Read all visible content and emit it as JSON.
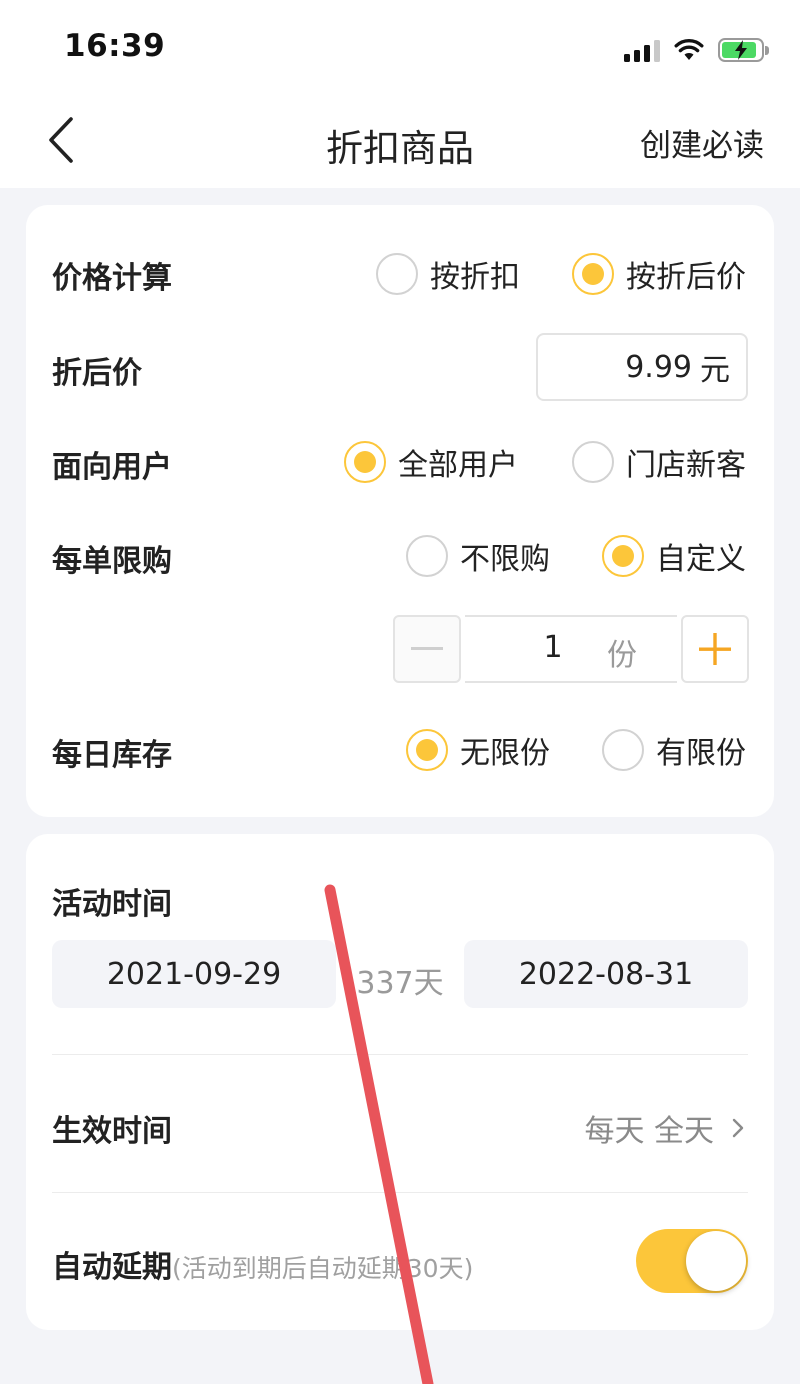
{
  "status_bar": {
    "time": "16:39"
  },
  "nav": {
    "title": "折扣商品",
    "right_link": "创建必读"
  },
  "price_calc": {
    "label": "价格计算",
    "options": [
      {
        "label": "按折扣",
        "selected": false
      },
      {
        "label": "按折后价",
        "selected": true
      }
    ]
  },
  "discount_price": {
    "label": "折后价",
    "value": "9.99",
    "unit": "元"
  },
  "target_users": {
    "label": "面向用户",
    "options": [
      {
        "label": "全部用户",
        "selected": true
      },
      {
        "label": "门店新客",
        "selected": false
      }
    ]
  },
  "order_limit": {
    "label": "每单限购",
    "options": [
      {
        "label": "不限购",
        "selected": false
      },
      {
        "label": "自定义",
        "selected": true
      }
    ],
    "quantity": "1",
    "quantity_unit": "份"
  },
  "daily_stock": {
    "label": "每日库存",
    "options": [
      {
        "label": "无限份",
        "selected": true
      },
      {
        "label": "有限份",
        "selected": false
      }
    ]
  },
  "activity_time": {
    "label": "活动时间",
    "start_date": "2021-09-29",
    "days": "337天",
    "end_date": "2022-08-31"
  },
  "effective_time": {
    "label": "生效时间",
    "value": "每天 全天"
  },
  "auto_extend": {
    "label": "自动延期",
    "hint": "(活动到期后自动延期30天)",
    "enabled": true
  },
  "colors": {
    "accent": "#fcc63a",
    "annotation_stroke": "#e8545a",
    "background": "#f3f4f8"
  }
}
